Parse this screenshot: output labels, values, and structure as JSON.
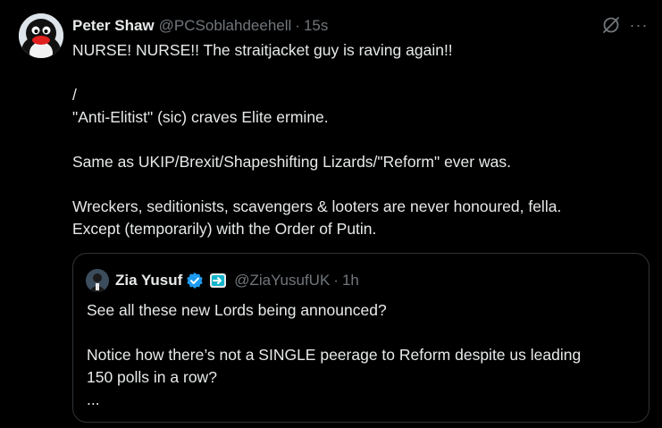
{
  "tweet": {
    "author_name": "Peter Shaw",
    "author_handle": "@PCSoblahdeehell",
    "separator": "·",
    "time": "15s",
    "lines": [
      "NURSE! NURSE!! The straitjacket guy is raving again!!",
      "",
      "/",
      "\"Anti-Elitist\" (sic) craves Elite ermine.",
      "",
      "Same as UKIP/Brexit/Shapeshifting Lizards/\"Reform\" ever was.",
      "",
      "Wreckers, seditionists, scavengers & looters are never honoured, fella.",
      "Except (temporarily) with the Order of Putin."
    ],
    "more_label": "···"
  },
  "quote": {
    "author_name": "Zia Yusuf",
    "author_handle": "@ZiaYusufUK",
    "separator": "·",
    "time": "1h",
    "lines": [
      "See all these new Lords being announced?",
      "",
      "Notice how there’s not a SINGLE peerage to Reform despite us leading",
      "150 polls in a row?",
      "..."
    ]
  },
  "icons": {
    "grok": "grok-icon",
    "more": "more-icon",
    "verified": "verified-badge-icon",
    "affiliate": "affiliate-badge-icon"
  },
  "colors": {
    "background": "#000000",
    "text": "#e7e9ea",
    "secondary": "#71767b",
    "verified": "#1d9bf0",
    "border": "#2f3336"
  }
}
